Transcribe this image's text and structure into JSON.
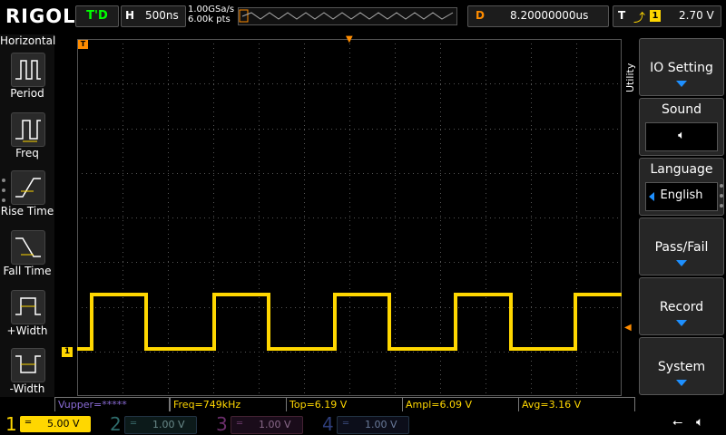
{
  "brand": "RIGOL",
  "status": "T'D",
  "horizontal": {
    "label": "H",
    "timebase": "500ns",
    "sample_rate": "1.00GSa/s",
    "mem_depth": "6.00k pts"
  },
  "delay": {
    "label": "D",
    "value": "8.20000000us"
  },
  "trigger": {
    "label": "T",
    "source": "1",
    "level": "2.70 V"
  },
  "left_menu": {
    "title": "Horizontal",
    "items": [
      {
        "label": "Period",
        "icon": "period-icon"
      },
      {
        "label": "Freq",
        "icon": "freq-icon"
      },
      {
        "label": "Rise Time",
        "icon": "rise-time-icon"
      },
      {
        "label": "Fall Time",
        "icon": "fall-time-icon"
      },
      {
        "label": "+Width",
        "icon": "pos-width-icon"
      },
      {
        "label": "-Width",
        "icon": "neg-width-icon"
      }
    ]
  },
  "right_menu": {
    "tab": "Utility",
    "io_setting": "IO Setting",
    "sound": "Sound",
    "language": "Language",
    "language_value": "English",
    "pass_fail": "Pass/Fail",
    "record": "Record",
    "system": "System"
  },
  "measurements": {
    "vupper": "Vupper=*****",
    "freq": "Freq=749kHz",
    "top": "Top=6.19 V",
    "ampl": "Ampl=6.09 V",
    "avg": "Avg=3.16 V"
  },
  "channels": [
    {
      "num": "1",
      "scale": "5.00 V",
      "color": "#ffd700",
      "active": true
    },
    {
      "num": "2",
      "scale": "1.00 V",
      "color": "#00c8c8",
      "active": false
    },
    {
      "num": "3",
      "scale": "1.00 V",
      "color": "#c800c8",
      "active": false
    },
    {
      "num": "4",
      "scale": "1.00 V",
      "color": "#1e64ff",
      "active": false
    }
  ],
  "ch1_marker": "1",
  "trigger_marker": "T",
  "colors": {
    "ch1": "#ffd700",
    "trigger": "#ff8c00",
    "accent": "#1e90ff"
  }
}
